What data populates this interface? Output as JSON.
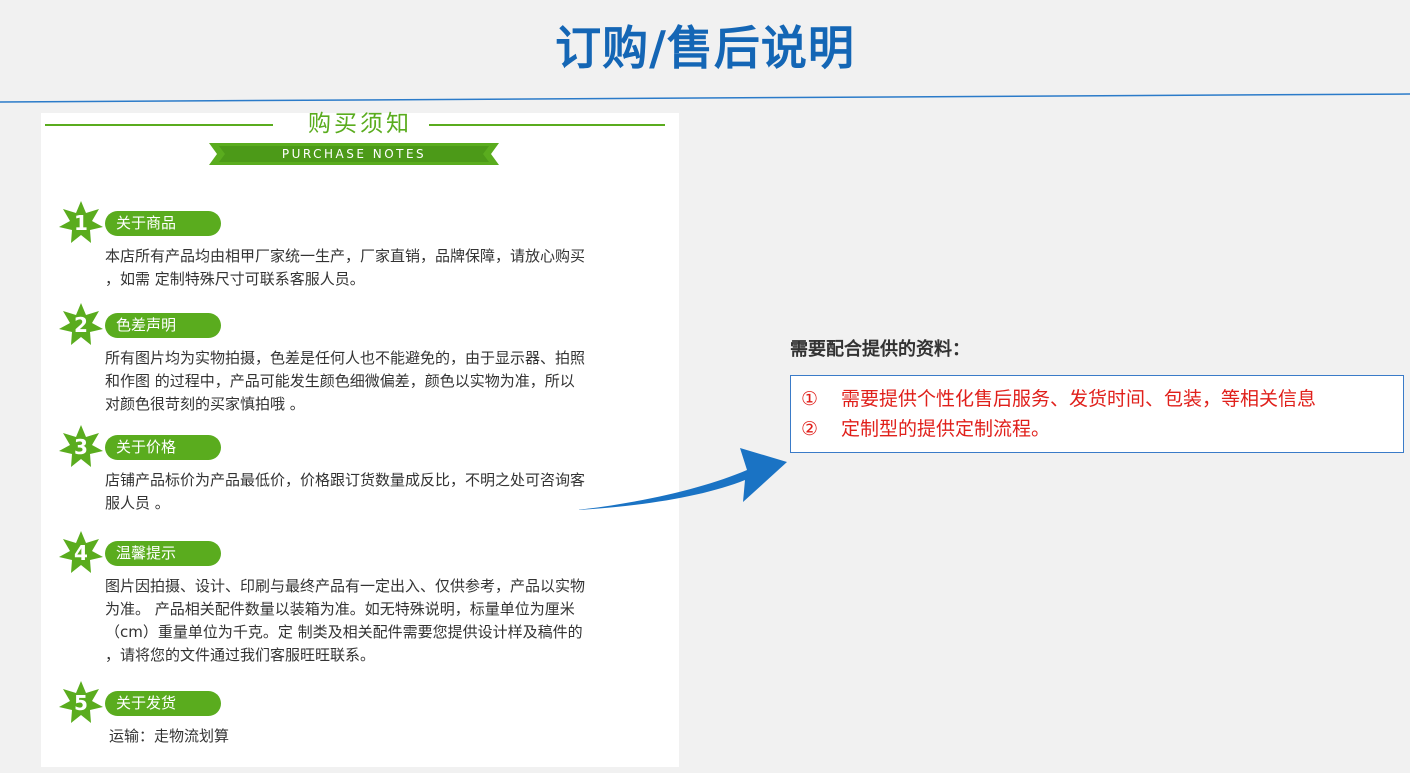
{
  "page": {
    "title": "订购/售后说明"
  },
  "notes": {
    "title": "购买须知",
    "subtitle": "PURCHASE NOTES",
    "sections": [
      {
        "number": "1",
        "heading": "关于商品",
        "text": "本店所有产品均由相甲厂家统一生产，厂家直销，品牌保障，请放心购买\n，如需 定制特殊尺寸可联系客服人员。"
      },
      {
        "number": "2",
        "heading": "色差声明",
        "text": "所有图片均为实物拍摄，色差是任何人也不能避免的，由于显示器、拍照\n和作图 的过程中，产品可能发生颜色细微偏差，颜色以实物为准，所以\n对颜色很苛刻的买家慎拍哦 。"
      },
      {
        "number": "3",
        "heading": "关于价格",
        "text": "店铺产品标价为产品最低价，价格跟订货数量成反比，不明之处可咨询客\n服人员 。"
      },
      {
        "number": "4",
        "heading": "温馨提示",
        "text": "图片因拍摄、设计、印刷与最终产品有一定出入、仅供参考，产品以实物\n为准。 产品相关配件数量以装箱为准。如无特殊说明，标量单位为厘米\n（cm）重量单位为千克。定 制类及相关配件需要您提供设计样及稿件的\n，请将您的文件通过我们客服旺旺联系。"
      },
      {
        "number": "5",
        "heading": "关于发货",
        "text": "运输：走物流划算"
      }
    ]
  },
  "requirements": {
    "title": "需要配合提供的资料：",
    "items": [
      {
        "num": "①",
        "text": "需要提供个性化售后服务、发货时间、包装，等相关信息"
      },
      {
        "num": "②",
        "text": "定制型的提供定制流程。"
      }
    ]
  },
  "colors": {
    "title_blue": "#1466b5",
    "accent_green": "#5aac1e",
    "arrow_blue": "#1a73c4",
    "requirement_red": "#e0201b"
  }
}
